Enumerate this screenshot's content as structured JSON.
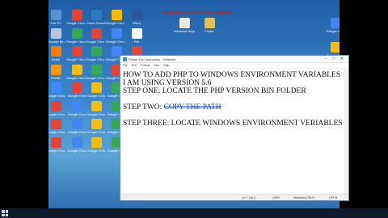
{
  "banner": {
    "text": "SOONYTECH SOLUTIONS"
  },
  "desktop_icons": [
    {
      "label": "This PC",
      "color": "#5a8fd0"
    },
    {
      "label": "Google Chro...",
      "color": "#e94235"
    },
    {
      "label": "Cisco Packet",
      "color": "#2a7bbf"
    },
    {
      "label": "Google Chro...",
      "color": "#fbbc05"
    },
    {
      "label": "Word",
      "color": "#2b579a"
    },
    {
      "label": "Recycle Bin",
      "color": "#b8c8d8"
    },
    {
      "label": "Google Chro...",
      "color": "#34a853"
    },
    {
      "label": "Google Chro...",
      "color": "#e94235"
    },
    {
      "label": "Google Chro...",
      "color": "#4285f4"
    },
    {
      "label": "File",
      "color": "#ffffff"
    },
    {
      "label": "Avast",
      "color": "#ff7800"
    },
    {
      "label": "Google Chro...",
      "color": "#e94235"
    },
    {
      "label": "Google Chro...",
      "color": "#34a853"
    },
    {
      "label": "Google Chro...",
      "color": "#4285f4"
    },
    {
      "label": "Google Chro...",
      "color": "#e94235"
    },
    {
      "label": "Firefox",
      "color": "#ff9500"
    },
    {
      "label": "Google Chro...",
      "color": "#fbbc05"
    },
    {
      "label": "Google Chro...",
      "color": "#34a853"
    },
    {
      "label": "Google Chro...",
      "color": "#e94235"
    },
    {
      "label": "File",
      "color": "#ffffff"
    },
    {
      "label": "Google Chro",
      "color": "#4285f4"
    },
    {
      "label": "Google Chro",
      "color": "#e94235"
    },
    {
      "label": "Google Chro",
      "color": "#fbbc05"
    },
    {
      "label": "Google Chro",
      "color": "#34a853"
    },
    {
      "label": "File",
      "color": "#ffffff"
    },
    {
      "label": "Google Chro",
      "color": "#e94235"
    },
    {
      "label": "Google Chro",
      "color": "#4285f4"
    },
    {
      "label": "Google Chro",
      "color": "#fbbc05"
    },
    {
      "label": "Google Chro",
      "color": "#34a853"
    },
    {
      "label": "File",
      "color": "#ffffff"
    },
    {
      "label": "Google Chro",
      "color": "#e94235"
    },
    {
      "label": "Google Chro",
      "color": "#4285f4"
    },
    {
      "label": "Google Chro",
      "color": "#fbbc05"
    },
    {
      "label": "Google Chro",
      "color": "#34a853"
    },
    {
      "label": "File",
      "color": "#ffffff"
    },
    {
      "label": "Google Chro",
      "color": "#e94235"
    },
    {
      "label": "Google Chro",
      "color": "#4285f4"
    },
    {
      "label": "Google Chro",
      "color": "#fbbc05"
    },
    {
      "label": "Google Chro",
      "color": "#34a853"
    },
    {
      "label": "Google Chro",
      "color": "#e94235"
    }
  ],
  "top_right_icons": [
    {
      "label": "Windows Repair",
      "color": "#e8e8e8"
    },
    {
      "label": "Folder",
      "color": "#e8c14a"
    },
    {
      "label": "Google Chro",
      "color": "#4285f4"
    },
    {
      "label": "Google Chro",
      "color": "#fbbc05"
    }
  ],
  "notepad": {
    "title": "Phase Two Instruction - Notepad",
    "menu": [
      "File",
      "Edit",
      "Format",
      "View",
      "Help"
    ],
    "lines": [
      "HOW TO ADD PHP TO WINDOWS ENVIRONMENT VARIABLES",
      "I AM USING VERSION 5.6",
      "STEP ONE: LOCATE THE PHP VERSION BIN FOLDER",
      "",
      "STEP TWO: ",
      "",
      "STEP THREE: LOCATE WINDOWS ENVIRONMENT VERIABLES"
    ],
    "selected_text": "COPY THE PATH",
    "status": {
      "position": "Ln 7, Col 4",
      "zoom": "100%",
      "line_ending": "Windows (CRLF)",
      "encoding": "UTF-8"
    }
  }
}
